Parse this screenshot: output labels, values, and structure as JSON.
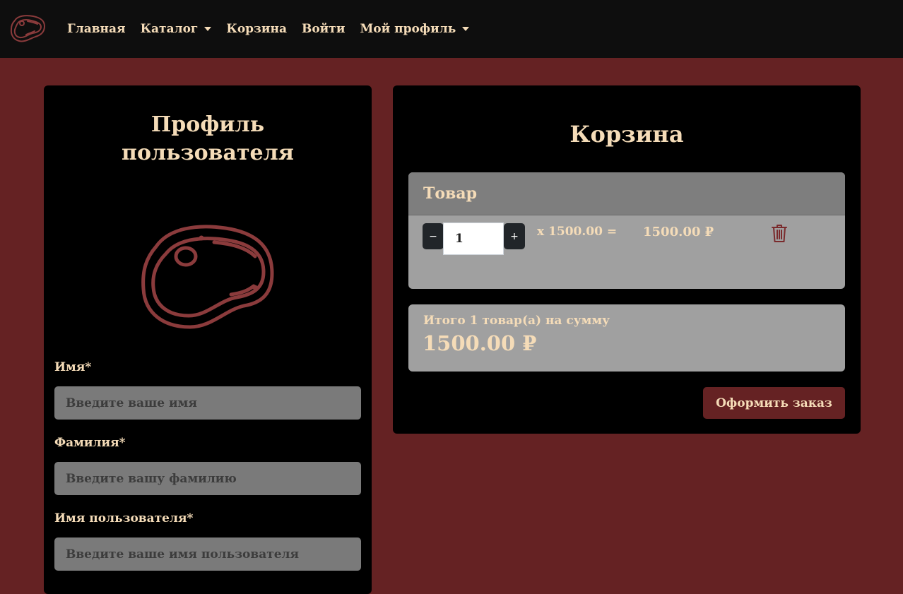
{
  "nav": {
    "home": "Главная",
    "catalog": "Каталог",
    "cart": "Корзина",
    "login": "Войти",
    "profile": "Мой профиль"
  },
  "profile": {
    "title": "Профиль пользователя",
    "first_name_label": "Имя*",
    "first_name_placeholder": "Введите ваше имя",
    "last_name_label": "Фамилия*",
    "last_name_placeholder": "Введите вашу фамилию",
    "username_label": "Имя пользователя*",
    "username_placeholder": "Введите ваше имя пользователя"
  },
  "cart": {
    "title": "Корзина",
    "column_header": "Товар",
    "items": [
      {
        "quantity": "1",
        "decrement": "−",
        "increment": "+",
        "unit_price": "x 1500.00 =",
        "total": "1500.00 ₽"
      }
    ],
    "summary_text": "Итого 1 товар(а) на сумму",
    "summary_total": "1500.00 ₽",
    "checkout_label": "Оформить заказ"
  },
  "colors": {
    "page_bg": "#652223",
    "navbar_bg": "#0e0e0e",
    "card_bg": "#000000",
    "text_cream": "#f5dcb8",
    "accent_steak": "#8b3b3c",
    "panel_gray": "#a0a0a0",
    "input_gray": "#7a7a7a"
  },
  "icons": {
    "brand": "steak-icon",
    "trash": "trash-icon"
  }
}
